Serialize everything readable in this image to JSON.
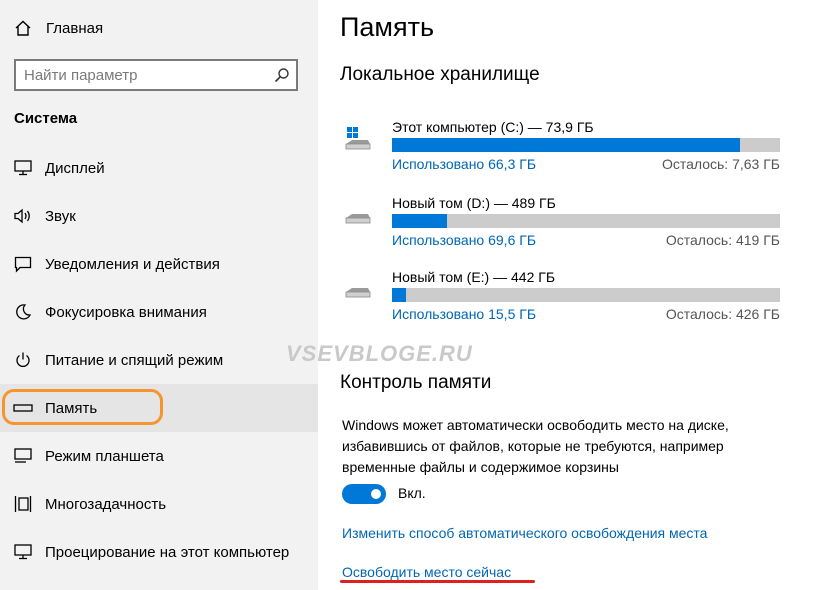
{
  "sidebar": {
    "home_label": "Главная",
    "search_placeholder": "Найти параметр",
    "section_title": "Система",
    "items": [
      {
        "label": "Дисплей",
        "icon": "display-icon"
      },
      {
        "label": "Звук",
        "icon": "sound-icon"
      },
      {
        "label": "Уведомления и действия",
        "icon": "notifications-icon"
      },
      {
        "label": "Фокусировка внимания",
        "icon": "focus-moon-icon"
      },
      {
        "label": "Питание и спящий режим",
        "icon": "power-icon"
      },
      {
        "label": "Память",
        "icon": "storage-icon",
        "selected": true
      },
      {
        "label": "Режим планшета",
        "icon": "tablet-icon"
      },
      {
        "label": "Многозадачность",
        "icon": "multitasking-icon"
      },
      {
        "label": "Проецирование на этот компьютер",
        "icon": "projecting-icon"
      }
    ]
  },
  "watermark": "VSEVBLOGE.RU",
  "main": {
    "title": "Память",
    "local_storage_title": "Локальное хранилище",
    "drives": [
      {
        "name": "Этот компьютер (C:) — 73,9 ГБ",
        "used": "Использовано 66,3 ГБ",
        "left": "Осталось: 7,63 ГБ",
        "used_fraction": 0.897,
        "icon": "windows-drive-icon"
      },
      {
        "name": "Новый том (D:) — 489 ГБ",
        "used": "Использовано 69,6 ГБ",
        "left": "Осталось: 419 ГБ",
        "used_fraction": 0.142,
        "icon": "drive-icon"
      },
      {
        "name": "Новый том (E:) — 442 ГБ",
        "used": "Использовано 15,5 ГБ",
        "left": "Осталось: 426 ГБ",
        "used_fraction": 0.035,
        "icon": "drive-icon"
      }
    ],
    "storage_sense_title": "Контроль памяти",
    "storage_sense_desc": "Windows может автоматически освободить место на диске, избавившись от файлов, которые не требуются, например временные файлы и содержимое корзины",
    "toggle_label": "Вкл.",
    "toggle_on": true,
    "change_link": "Изменить способ автоматического освобождения места",
    "free_now_link": "Освободить место сейчас"
  },
  "colors": {
    "accent": "#0078d7",
    "link": "#0066b4",
    "highlight_box": "#f59530",
    "underline": "#e02020"
  }
}
